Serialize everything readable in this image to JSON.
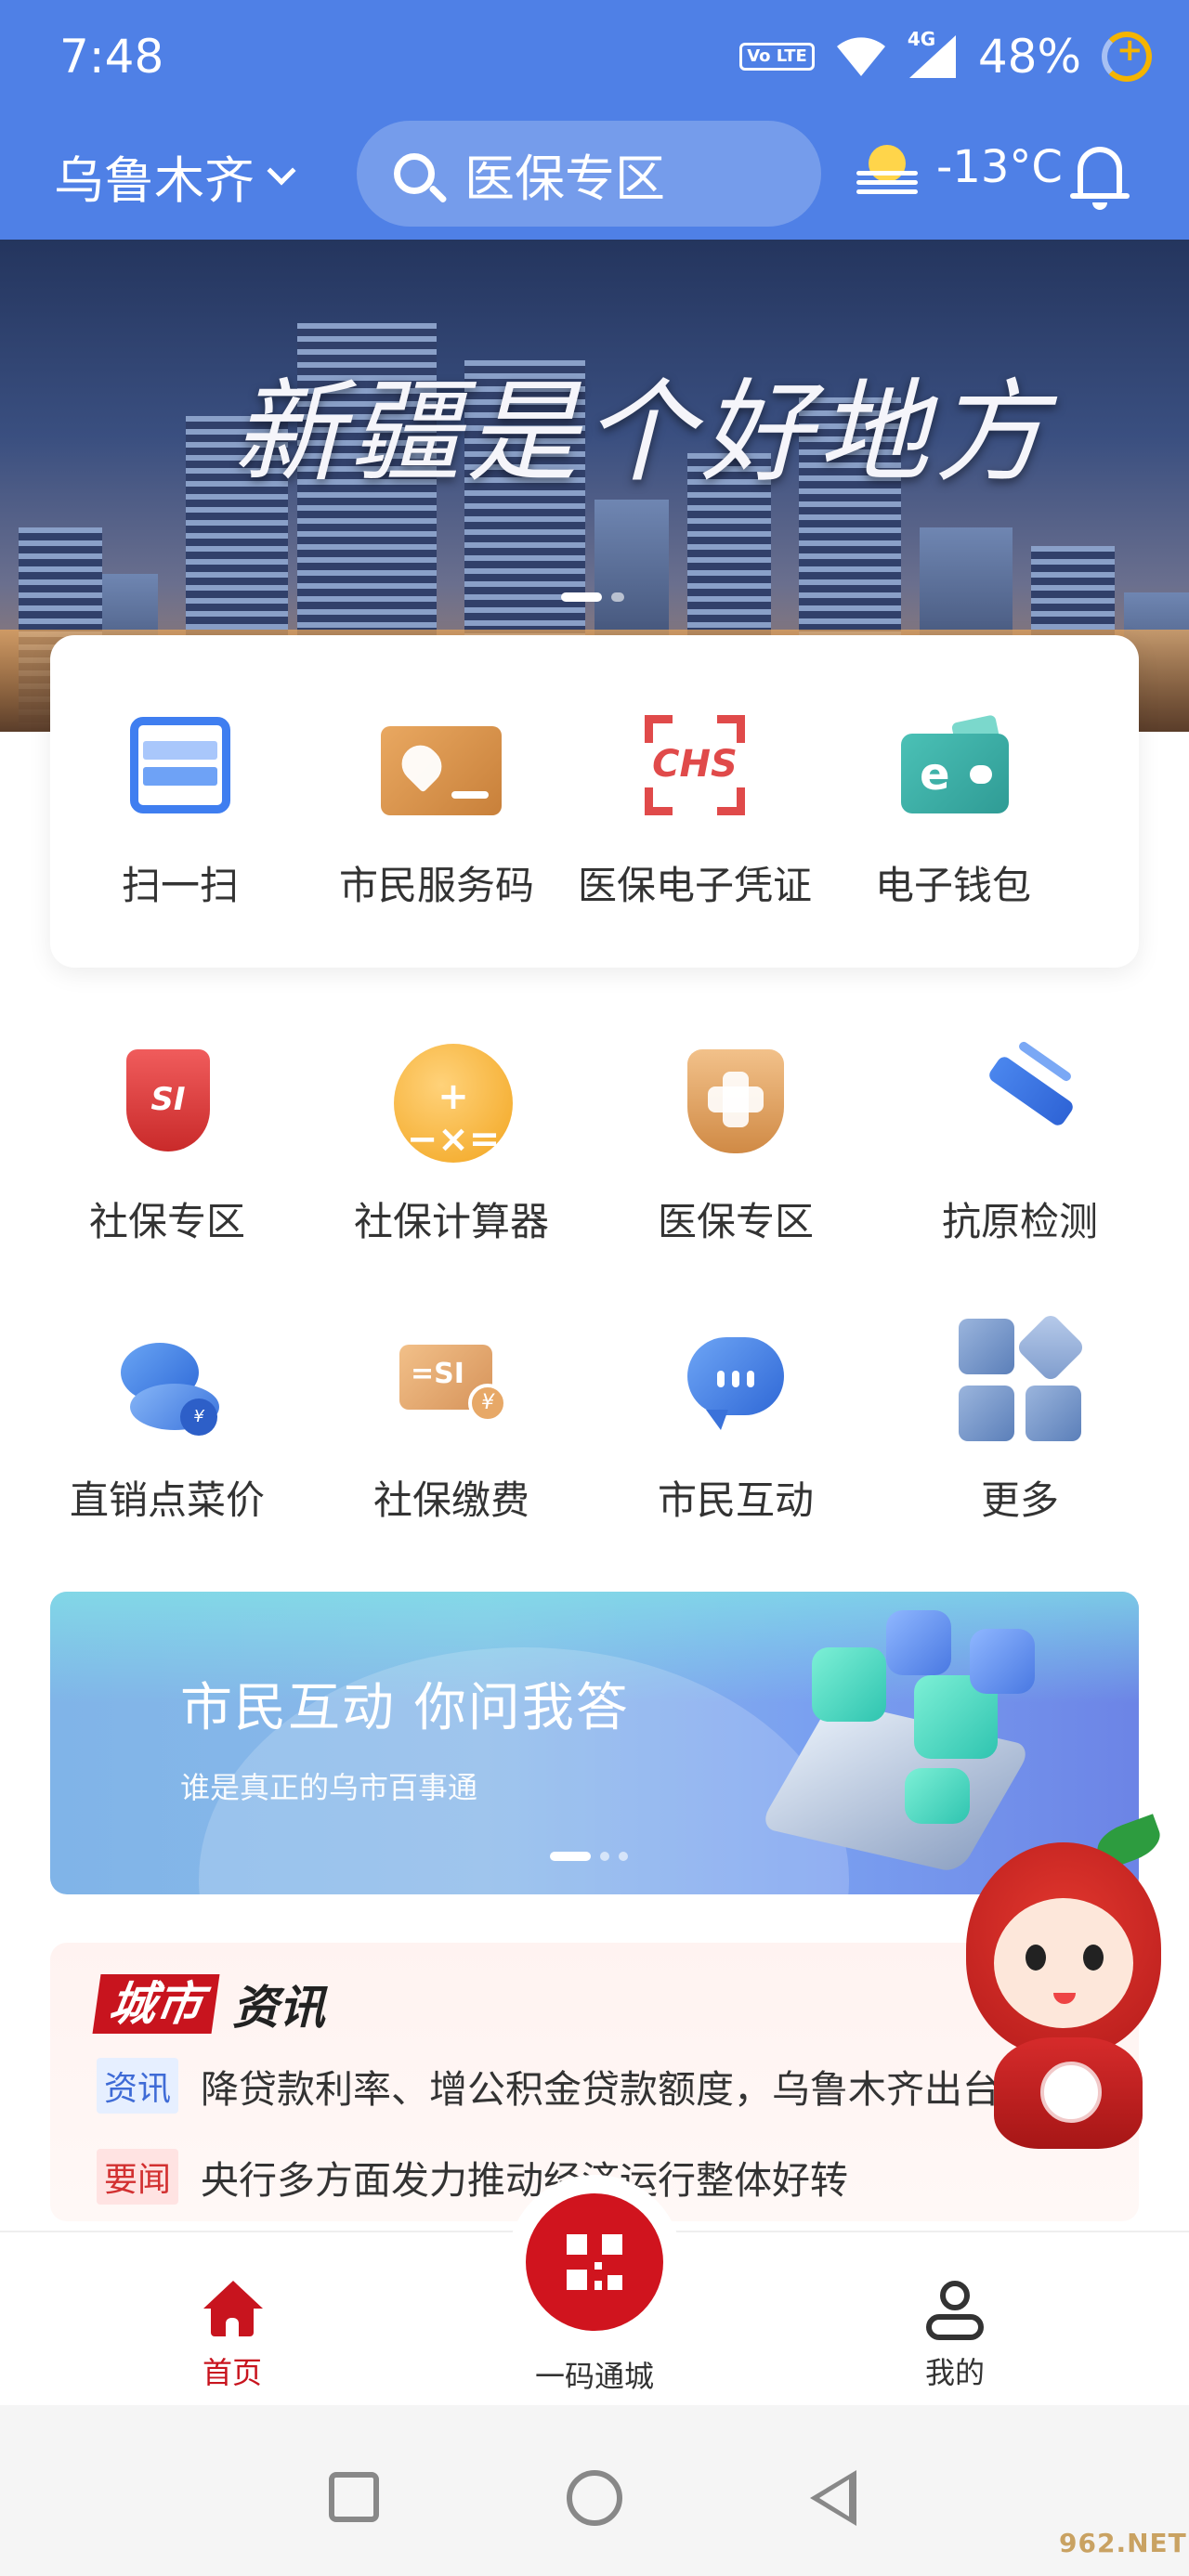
{
  "status_bar": {
    "time": "7:48",
    "volte": "Vo LTE",
    "network": "4G",
    "battery": "48%"
  },
  "header": {
    "city": "乌鲁木齐",
    "search_placeholder": "医保专区",
    "temperature": "-13°C"
  },
  "banner": {
    "slogan": "新疆是个好地方",
    "slide_count": 2,
    "active_slide": 1
  },
  "quick_actions": [
    {
      "label": "扫一扫",
      "icon": "scan-icon"
    },
    {
      "label": "市民服务码",
      "icon": "citizen-card-icon"
    },
    {
      "label": "医保电子凭证",
      "icon": "chs-certificate-icon"
    },
    {
      "label": "电子钱包",
      "icon": "e-wallet-icon"
    }
  ],
  "services": [
    {
      "label": "社保专区",
      "icon": "social-security-shield-icon"
    },
    {
      "label": "社保计算器",
      "icon": "calculator-icon"
    },
    {
      "label": "医保专区",
      "icon": "medical-insurance-shield-icon"
    },
    {
      "label": "抗原检测",
      "icon": "antigen-test-icon"
    },
    {
      "label": "直销点菜价",
      "icon": "vegetable-price-icon"
    },
    {
      "label": "社保缴费",
      "icon": "social-security-payment-icon"
    },
    {
      "label": "市民互动",
      "icon": "chat-bubble-icon"
    },
    {
      "label": "更多",
      "icon": "more-grid-icon"
    }
  ],
  "promo": {
    "title": "市民互动 你问我答",
    "subtitle": "谁是真正的乌市百事通",
    "slide_count": 3,
    "active_slide": 1
  },
  "news": {
    "brand_red": "城市",
    "brand_black": "资讯",
    "items": [
      {
        "tag": "资讯",
        "text": "降贷款利率、增公积金贷款额度，乌鲁木齐出台"
      },
      {
        "tag": "要闻",
        "text": "央行多方面发力推动经济运行整体好转"
      }
    ]
  },
  "tabbar": {
    "home": "首页",
    "qr": "一码通城",
    "me": "我的"
  },
  "watermark": "962.NET",
  "colors": {
    "header_blue": "#4f80e6",
    "brand_red": "#c8141e",
    "tag_blue": "#3f6bd6",
    "tag_red": "#d23030"
  }
}
